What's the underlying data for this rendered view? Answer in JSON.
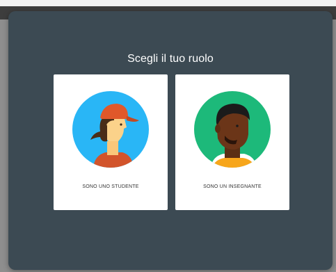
{
  "dialog": {
    "title": "Scegli il tuo ruolo",
    "background": "#3c4a53"
  },
  "roles": [
    {
      "label": "SONO UNO STUDENTE",
      "avatar_icon": "student-avatar-icon",
      "avatar_background": "#29b6f6"
    },
    {
      "label": "SONO UN INSEGNANTE",
      "avatar_icon": "teacher-avatar-icon",
      "avatar_background": "#1db97a"
    }
  ]
}
